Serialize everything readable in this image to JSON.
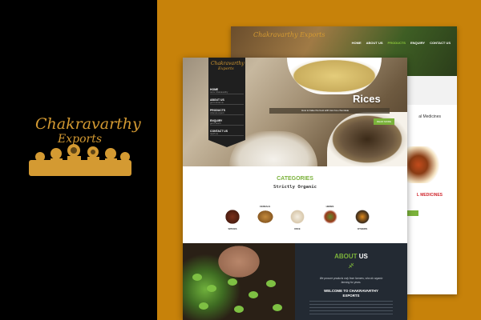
{
  "brand": {
    "line1": "Chakravarthy",
    "line2": "Exports"
  },
  "back_page": {
    "logo": "Chakravarthy Exports",
    "nav": [
      "HOME",
      "ABOUT US",
      "PRODUCTS",
      "ENQUIRY",
      "CONTACT US"
    ],
    "active_nav": "PRODUCTS",
    "side_text": "al Medicines",
    "red_text": "L MEDICINES"
  },
  "front_page": {
    "logo_line1": "Chakravarthy",
    "logo_line2": "Exports",
    "menu": [
      {
        "label": "HOME",
        "sub": "we're Chakravarthy"
      },
      {
        "label": "ABOUT US",
        "sub": "get to know us"
      },
      {
        "label": "PRODUCTS",
        "sub": "what we export"
      },
      {
        "label": "ENQUIRY",
        "sub": "get in touch"
      },
      {
        "label": "CONTACT US",
        "sub": "reach us"
      }
    ],
    "hero": {
      "title": "Rices",
      "subtitle": "How to bake the best with low rice-chocolate",
      "button": "READ MORE"
    },
    "categories": {
      "title": "CATEGORIES",
      "subtitle": "Strictly Organic",
      "items": [
        {
          "top": "",
          "label": "SPICES",
          "color": "#7a2f1a"
        },
        {
          "top": "CEREALS",
          "label": "",
          "color": "#c48a3c"
        },
        {
          "top": "",
          "label": "RICE",
          "color": "#e8dcc6"
        },
        {
          "top": "HERBS",
          "label": "",
          "color": "#5d8a2e"
        },
        {
          "top": "",
          "label": "OTHERS",
          "color": "#e08a1c"
        }
      ]
    },
    "about": {
      "title_a": "ABOUT",
      "title_b": "US",
      "line1": "We procure products only from farmers, who do organic",
      "line2": "farming for years.",
      "welcome1": "WELCOME TO CHAKRAVARTHY",
      "welcome2": "EXPORTS"
    }
  }
}
